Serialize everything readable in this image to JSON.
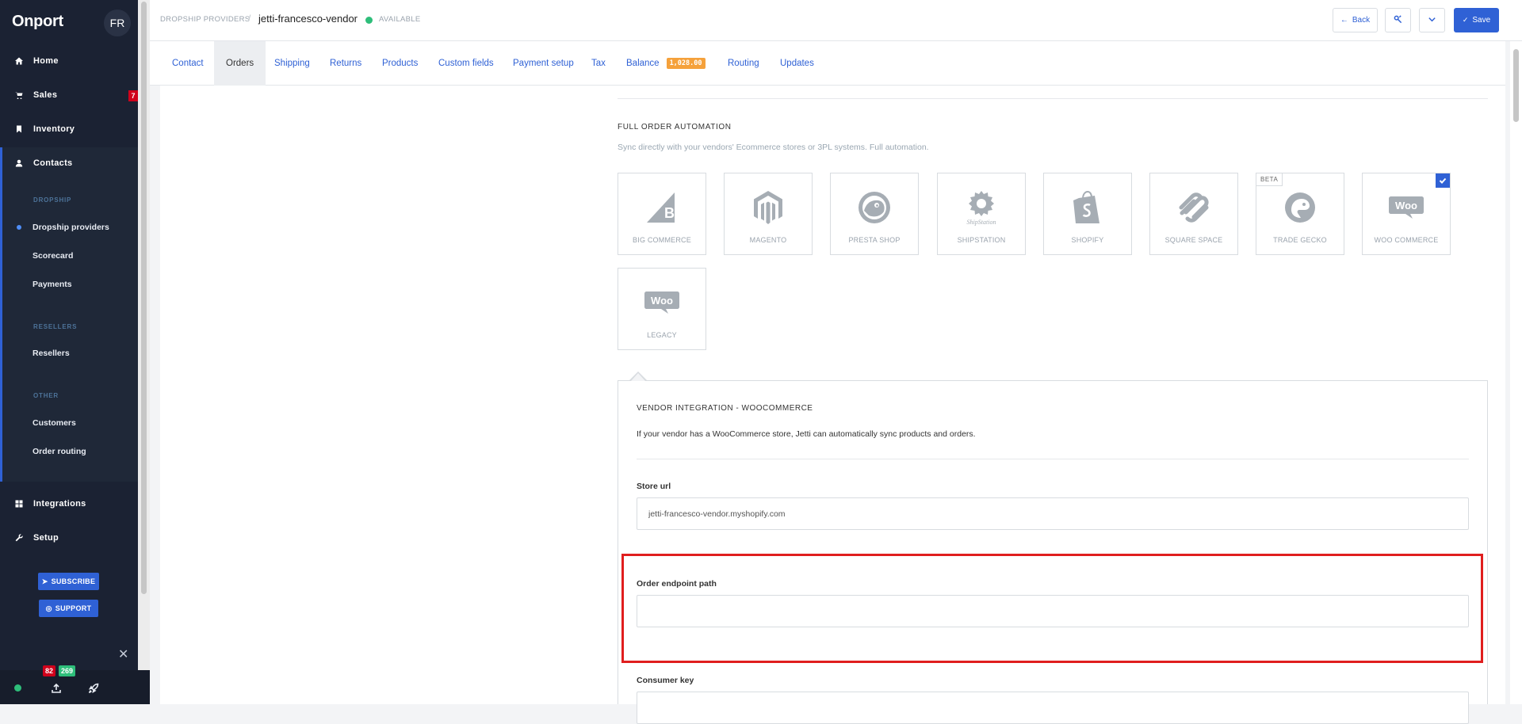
{
  "sidebar": {
    "brand": "Onport",
    "avatar": "FR",
    "items": [
      {
        "label": "Home",
        "icon": "home-icon"
      },
      {
        "label": "Sales",
        "icon": "cart-icon",
        "badge": "7"
      },
      {
        "label": "Inventory",
        "icon": "bookmark-icon"
      },
      {
        "label": "Contacts",
        "icon": "user-icon"
      },
      {
        "label": "Integrations",
        "icon": "grid-icon"
      },
      {
        "label": "Setup",
        "icon": "wrench-icon"
      }
    ],
    "sections": {
      "dropship": "DROPSHIP",
      "resellers": "RESELLERS",
      "other": "OTHER"
    },
    "sub_items": {
      "dropship_providers": "Dropship providers",
      "scorecard": "Scorecard",
      "payments": "Payments",
      "resellers": "Resellers",
      "customers": "Customers",
      "order_routing": "Order routing"
    },
    "subscribe_label": "SUBSCRIBE",
    "support_label": "SUPPORT",
    "close_glyph": "✕",
    "badge_red": "82",
    "badge_green": "269"
  },
  "header": {
    "breadcrumb": "DROPSHIP PROVIDERS",
    "separator": "/",
    "vendor_name": "jetti-francesco-vendor",
    "status": "AVAILABLE",
    "back_label": "Back",
    "save_label": "Save"
  },
  "tabs": {
    "contact": "Contact",
    "orders": "Orders",
    "shipping": "Shipping",
    "returns": "Returns",
    "products": "Products",
    "custom_fields": "Custom fields",
    "payment_setup": "Payment setup",
    "tax": "Tax",
    "balance": "Balance",
    "balance_value": "1,028.00",
    "routing": "Routing",
    "updates": "Updates"
  },
  "automation": {
    "title": "FULL ORDER AUTOMATION",
    "description": "Sync directly with your vendors' Ecommerce stores or 3PL systems. Full automation.",
    "platforms": {
      "bigcommerce": "BIG COMMERCE",
      "magento": "MAGENTO",
      "prestashop": "PRESTA SHOP",
      "shipstation": "SHIPSTATION",
      "shipstation_logo_text": "ShipStation",
      "shopify": "SHOPIFY",
      "squarespace": "SQUARE SPACE",
      "tradegecko": "TRADE GECKO",
      "woocommerce": "WOO COMMERCE",
      "legacy": "LEGACY",
      "beta_tag": "BETA",
      "woo_logo_text": "Woo"
    },
    "selected": "WOO COMMERCE"
  },
  "integration": {
    "title": "VENDOR INTEGRATION - WOOCOMMERCE",
    "description": "If your vendor has a WooCommerce store, Jetti can automatically sync products and orders.",
    "store_url_label": "Store url",
    "store_url_value": "jetti-francesco-vendor.myshopify.com",
    "order_endpoint_label": "Order endpoint path",
    "order_endpoint_value": "",
    "consumer_key_label": "Consumer key"
  },
  "colors": {
    "accent": "#2f61d5",
    "sidebar_bg": "#1b2233",
    "status_green": "#2ebe7a",
    "balance_badge": "#f5a13b",
    "highlight_red": "#e01e1e"
  }
}
